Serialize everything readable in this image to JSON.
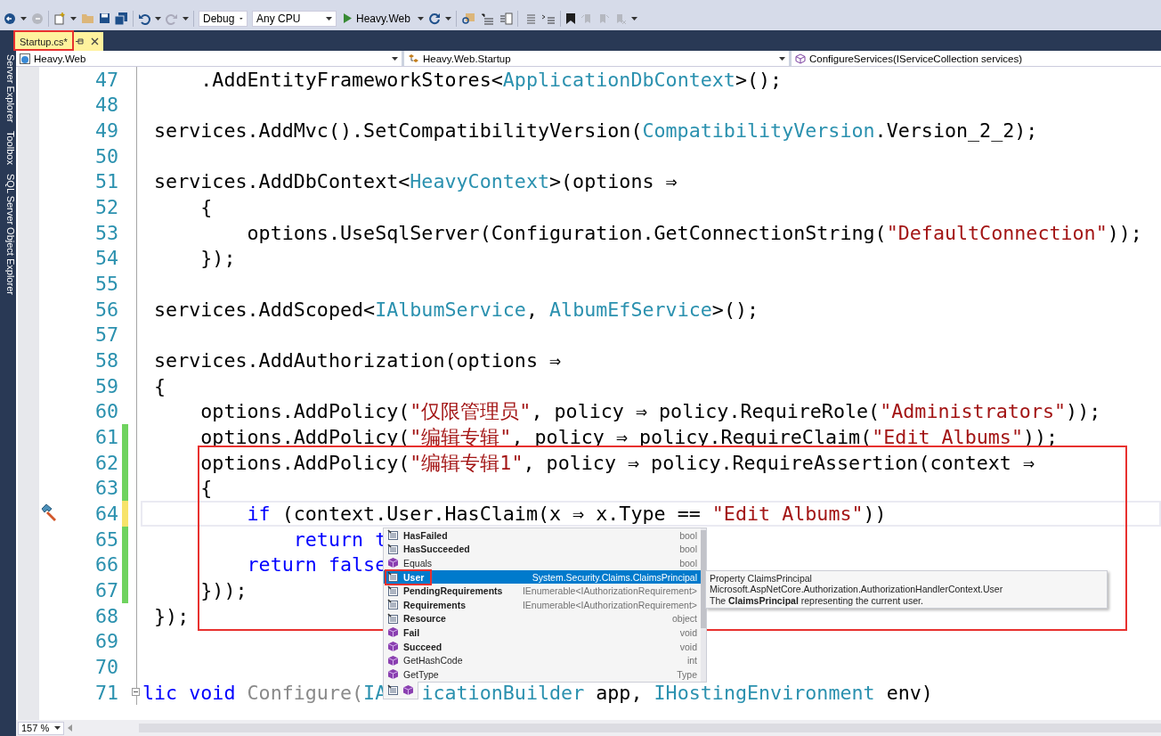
{
  "toolbar": {
    "configuration": "Debug",
    "platform": "Any CPU",
    "startup_project": "Heavy.Web"
  },
  "tabs": [
    {
      "label": "Startup.cs*",
      "selected": true
    }
  ],
  "side_panels": [
    "Server Explorer",
    "Toolbox",
    "SQL Server Object Explorer"
  ],
  "navigation": {
    "project": "Heavy.Web",
    "type": "Heavy.Web.Startup",
    "member": "ConfigureServices(IServiceCollection services)"
  },
  "editor": {
    "lines": [
      {
        "number": "47",
        "current": false,
        "changed": false,
        "tokens": [
          {
            "text": "     .AddEntityFrameworkStores<"
          },
          {
            "text": "ApplicationDbContext",
            "kind": "type"
          },
          {
            "text": ">();"
          }
        ]
      },
      {
        "number": "48",
        "current": false,
        "changed": false
      },
      {
        "number": "49",
        "current": false,
        "changed": false,
        "tokens": [
          {
            "text": " services.AddMvc().SetCompatibilityVersion("
          },
          {
            "text": "CompatibilityVersion",
            "kind": "type"
          },
          {
            "text": ".Version_2_2);"
          }
        ]
      },
      {
        "number": "50",
        "current": false,
        "changed": false
      },
      {
        "number": "51",
        "current": false,
        "changed": false,
        "tokens": [
          {
            "text": " services.AddDbContext<"
          },
          {
            "text": "HeavyContext",
            "kind": "type"
          },
          {
            "text": ">(options ⇒"
          }
        ]
      },
      {
        "number": "52",
        "current": false,
        "changed": false,
        "tokens": [
          {
            "text": "     {"
          }
        ]
      },
      {
        "number": "53",
        "current": false,
        "changed": false,
        "tokens": [
          {
            "text": "         options.UseSqlServer(Configuration.GetConnectionString("
          },
          {
            "text": "\"DefaultConnection\"",
            "kind": "string"
          },
          {
            "text": "));"
          }
        ]
      },
      {
        "number": "54",
        "current": false,
        "changed": false,
        "tokens": [
          {
            "text": "     });"
          }
        ]
      },
      {
        "number": "55",
        "current": false,
        "changed": false
      },
      {
        "number": "56",
        "current": false,
        "changed": false,
        "tokens": [
          {
            "text": " services.AddScoped<"
          },
          {
            "text": "IAlbumService",
            "kind": "type"
          },
          {
            "text": ", "
          },
          {
            "text": "AlbumEfService",
            "kind": "type"
          },
          {
            "text": ">();"
          }
        ]
      },
      {
        "number": "57",
        "current": false,
        "changed": false
      },
      {
        "number": "58",
        "current": false,
        "changed": false,
        "tokens": [
          {
            "text": " services.AddAuthorization(options ⇒"
          }
        ]
      },
      {
        "number": "59",
        "current": false,
        "changed": false,
        "tokens": [
          {
            "text": " {"
          }
        ]
      },
      {
        "number": "60",
        "current": false,
        "changed": false,
        "tokens": [
          {
            "text": "     options.AddPolicy("
          },
          {
            "text": "\"仅限管理员\"",
            "kind": "string"
          },
          {
            "text": ", policy ⇒ policy.RequireRole("
          },
          {
            "text": "\"Administrators\"",
            "kind": "string"
          },
          {
            "text": "));"
          }
        ]
      },
      {
        "number": "61",
        "current": false,
        "changed": true,
        "saved": true,
        "tokens": [
          {
            "text": "     options.AddPolicy("
          },
          {
            "text": "\"编辑专辑\"",
            "kind": "string"
          },
          {
            "text": ", policy ⇒ policy.RequireClaim("
          },
          {
            "text": "\"Edit Albums\"",
            "kind": "string"
          },
          {
            "text": "));"
          }
        ]
      },
      {
        "number": "62",
        "current": false,
        "changed": true,
        "saved": true,
        "tokens": [
          {
            "text": "     options.AddPolicy("
          },
          {
            "text": "\"编辑专辑1\"",
            "kind": "string"
          },
          {
            "text": ", policy ⇒ policy.RequireAssertion(context ⇒"
          }
        ]
      },
      {
        "number": "63",
        "current": false,
        "changed": true,
        "saved": true,
        "tokens": [
          {
            "text": "     {"
          }
        ]
      },
      {
        "number": "64",
        "current": true,
        "changed": true,
        "saved": false,
        "quick_action": true,
        "tokens": [
          {
            "text": "         if",
            "kind": "keyword"
          },
          {
            "text": " (context.User.HasClaim(x ⇒ x.Type == "
          },
          {
            "text": "\"Edit Albums\"",
            "kind": "string"
          },
          {
            "text": "))"
          }
        ]
      },
      {
        "number": "65",
        "current": false,
        "changed": true,
        "saved": true,
        "tokens": [
          {
            "text": "             return t",
            "kind": "keyword"
          }
        ]
      },
      {
        "number": "66",
        "current": false,
        "changed": true,
        "saved": true,
        "tokens": [
          {
            "text": "         return false",
            "kind": "keyword"
          }
        ]
      },
      {
        "number": "67",
        "current": false,
        "changed": true,
        "saved": true,
        "tokens": [
          {
            "text": "     }));"
          }
        ]
      },
      {
        "number": "68",
        "current": false,
        "changed": false,
        "tokens": [
          {
            "text": " });"
          }
        ]
      },
      {
        "number": "69",
        "current": false,
        "changed": false
      },
      {
        "number": "70",
        "current": false,
        "changed": false
      },
      {
        "number": "71",
        "current": false,
        "changed": false,
        "collapsible": true,
        "tokens": [
          {
            "text": "lic void",
            "kind": "keyword"
          },
          {
            "text": " Configure(",
            "kind": "dim"
          },
          {
            "text": "IA",
            "kind": "type"
          },
          {
            "kind": "covered"
          },
          {
            "text": "icationBuilder",
            "kind": "type"
          },
          {
            "text": " app, "
          },
          {
            "text": "IHostingEnvironment",
            "kind": "type"
          },
          {
            "text": " env)"
          }
        ]
      }
    ]
  },
  "completion": {
    "items": [
      {
        "name": "HasFailed",
        "type": "bool",
        "kind": "property",
        "emphasized": true,
        "selected": false
      },
      {
        "name": "HasSucceeded",
        "type": "bool",
        "kind": "property",
        "emphasized": true,
        "selected": false
      },
      {
        "name": "Equals",
        "type": "bool",
        "kind": "method",
        "emphasized": false,
        "selected": false
      },
      {
        "name": "User",
        "type": "System.Security.Claims.ClaimsPrincipal",
        "kind": "property",
        "emphasized": true,
        "selected": true
      },
      {
        "name": "PendingRequirements",
        "type": "IEnumerable<IAuthorizationRequirement>",
        "kind": "property",
        "emphasized": true,
        "selected": false
      },
      {
        "name": "Requirements",
        "type": "IEnumerable<IAuthorizationRequirement>",
        "kind": "property",
        "emphasized": true,
        "selected": false
      },
      {
        "name": "Resource",
        "type": "object",
        "kind": "property",
        "emphasized": true,
        "selected": false
      },
      {
        "name": "Fail",
        "type": "void",
        "kind": "method",
        "emphasized": true,
        "selected": false
      },
      {
        "name": "Succeed",
        "type": "void",
        "kind": "method",
        "emphasized": true,
        "selected": false
      },
      {
        "name": "GetHashCode",
        "type": "int",
        "kind": "method",
        "emphasized": false,
        "selected": false
      },
      {
        "name": "GetType",
        "type": "Type",
        "kind": "method",
        "emphasized": false,
        "selected": false
      }
    ],
    "tooltip": {
      "signature": "Property ClaimsPrincipal Microsoft.AspNetCore.Authorization.AuthorizationHandlerContext.User",
      "description": "The **ClaimsPrincipal** representing the current user."
    }
  },
  "status": {
    "zoom": "157 %"
  }
}
